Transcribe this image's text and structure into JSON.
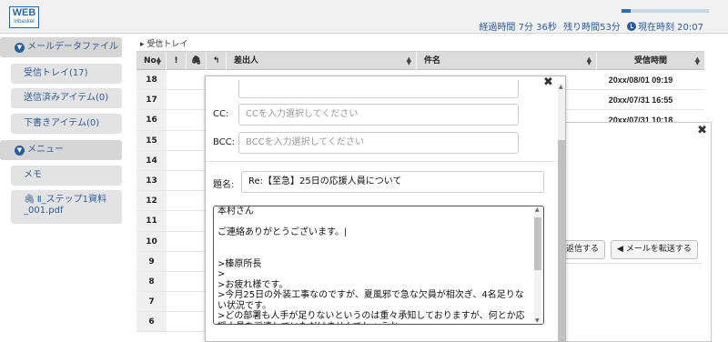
{
  "header": {
    "logo_line1": "WEB",
    "logo_line2": "Inbasket",
    "progress_fraction": 0.1,
    "elapsed": "経過時間 7分 36秒",
    "remaining": "残り時間53分",
    "current_time": "現在時刻 20:07"
  },
  "sidebar": {
    "mail_section": "メールデータファイル",
    "inbox": "受信トレイ(17)",
    "sent": "送信済みアイテム(0)",
    "drafts": "下書きアイテム(0)",
    "memo_section": "メニュー",
    "memo": "メモ",
    "attachment": "Ⅱ_ステップ1資料_001.pdf"
  },
  "list": {
    "breadcrumb": "受信トレイ",
    "columns": {
      "no": "No",
      "important": "!",
      "sender": "差出人",
      "subject": "件名",
      "received": "受信時間"
    },
    "rows": [
      {
        "no": "18",
        "date": "20xx/08/01 09:19"
      },
      {
        "no": "17",
        "date": "20xx/07/31 16:55"
      },
      {
        "no": "16",
        "date": "20xx/07/31 10:18"
      },
      {
        "no": "15",
        "date": ""
      },
      {
        "no": "14",
        "date": ""
      },
      {
        "no": "13",
        "date": ""
      },
      {
        "no": "12",
        "date": ""
      },
      {
        "no": "11",
        "date": ""
      },
      {
        "no": "10",
        "date": ""
      },
      {
        "no": "9",
        "date": ""
      },
      {
        "no": "8",
        "date": ""
      },
      {
        "no": "7",
        "date": ""
      },
      {
        "no": "6",
        "date": ""
      }
    ]
  },
  "detail": {
    "reply_button": "返信する",
    "forward_button": "メールを転送する"
  },
  "compose": {
    "cc_label": "CC:",
    "cc_placeholder": "CCを入力選択してください",
    "bcc_label": "BCC:",
    "bcc_placeholder": "BCCを入力選択してください",
    "subject_label": "題名:",
    "subject_value": "Re:【至急】25日の応援人員について",
    "body_lines": [
      "本村さん",
      "",
      "ご連絡ありがとうございます。|",
      "",
      "",
      ">榛原所長",
      ">",
      ">お疲れ様です。",
      ">今月25日の外装工事なのですが、夏風邪で急な欠員が相次ぎ、4名足りない状況です。",
      ">どの部署も人手が足りないというのは重々承知しておりますが、何とか応援人員を派遣していただけませんでしょうか。"
    ]
  },
  "icons": {
    "paperclip": "paperclip-icon",
    "reply_arrow": "reply-icon",
    "close": "close-icon",
    "clock": "clock-icon"
  }
}
